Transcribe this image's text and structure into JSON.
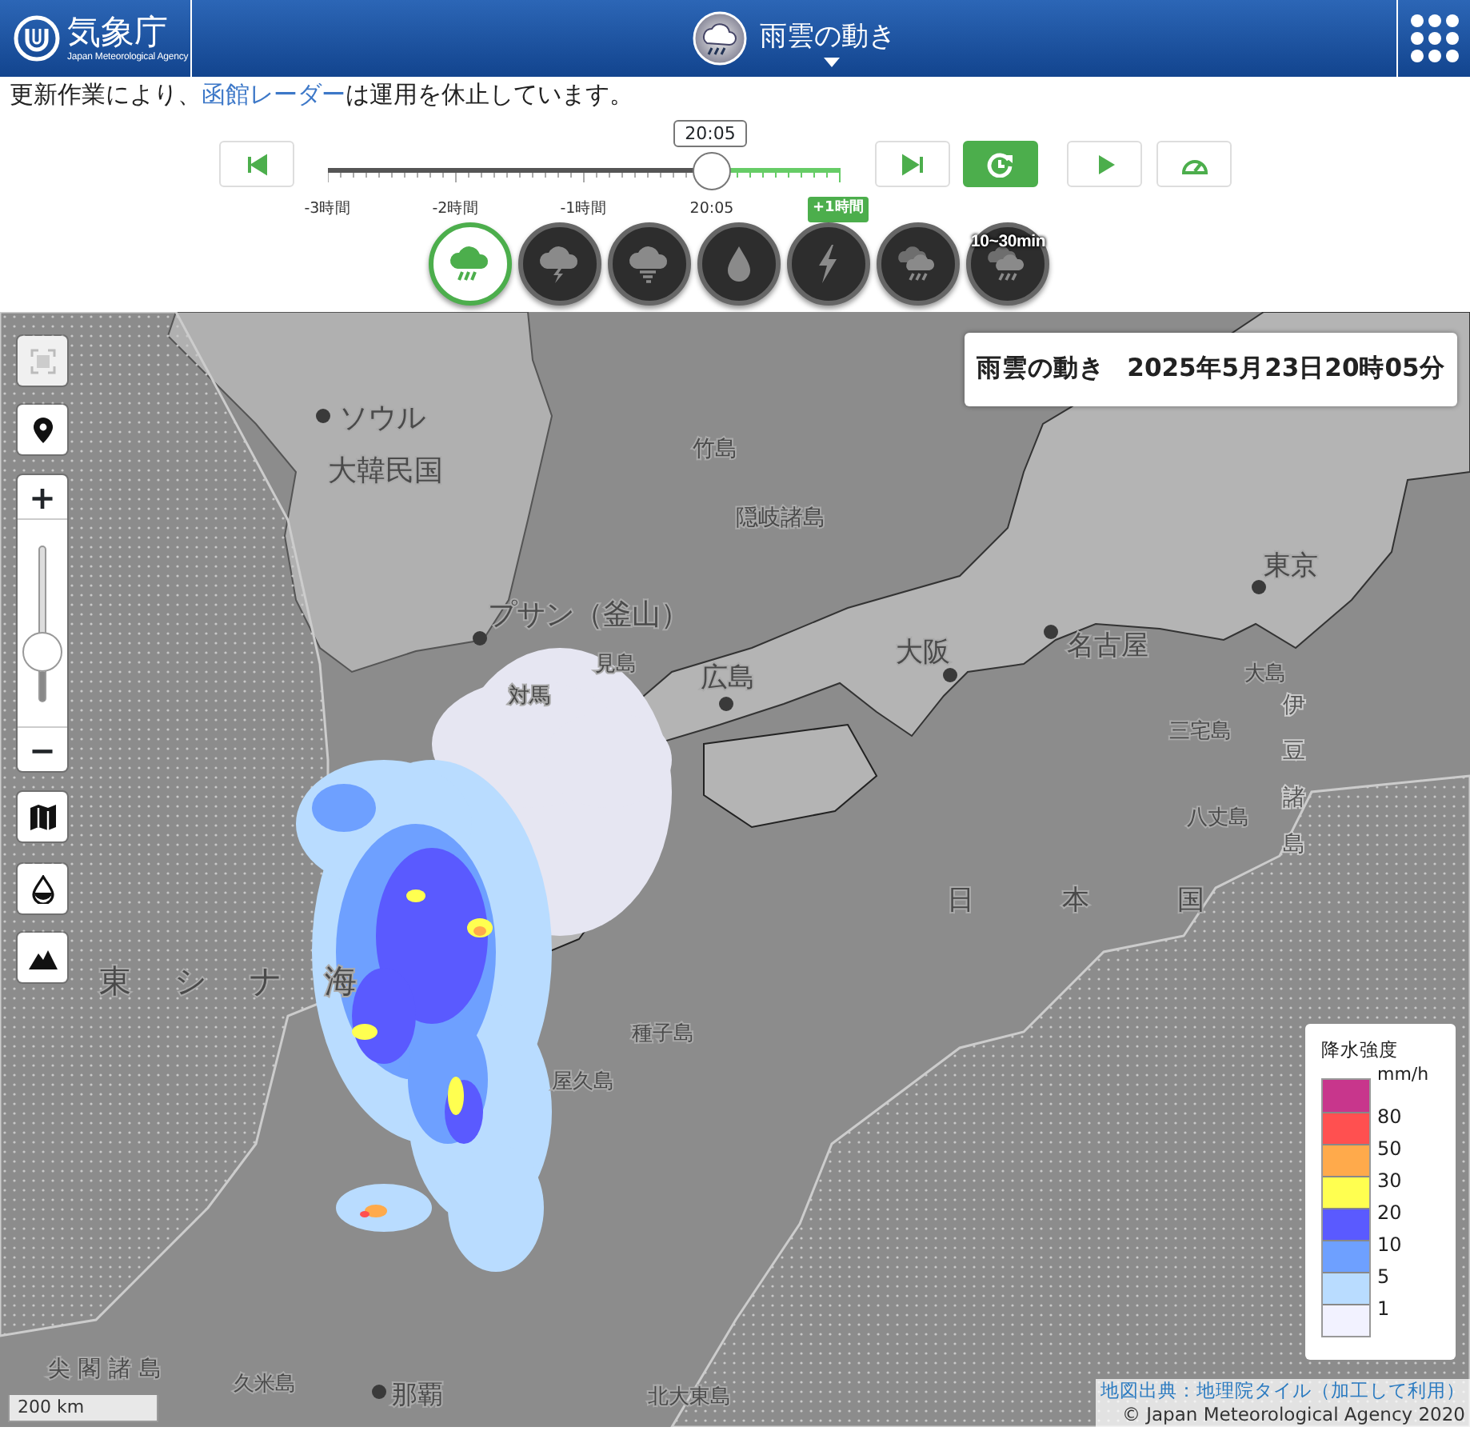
{
  "header": {
    "logo": {
      "name": "気象庁",
      "subtitle": "Japan Meteorological Agency"
    },
    "title": "雨雲の動き"
  },
  "notice": {
    "before": "更新作業により、",
    "link": "函館レーダー",
    "after": "は運用を休止しています。"
  },
  "player": {
    "time": "20:05",
    "level": 0.75,
    "ticks": [
      "-3時間",
      "-2時間",
      "-1時間",
      "20:05"
    ],
    "future_label": "+1時間",
    "buttons": [
      {
        "kind": "first",
        "on": false
      },
      {
        "kind": "last",
        "on": false
      },
      {
        "kind": "refresh",
        "on": true
      },
      {
        "kind": "play",
        "on": false
      },
      {
        "kind": "speed",
        "on": false
      }
    ]
  },
  "modes": [
    {
      "kind": "rain",
      "selected": true
    },
    {
      "kind": "thunder",
      "selected": false
    },
    {
      "kind": "tornado",
      "selected": false
    },
    {
      "kind": "drop",
      "selected": false
    },
    {
      "kind": "lightning",
      "selected": false
    },
    {
      "kind": "nowcast",
      "selected": false
    },
    {
      "kind": "nowcast",
      "label": "10~30min",
      "selected": false
    }
  ],
  "map": {
    "title": "雨雲の動き",
    "datetime": "2025年5月23日20時05分",
    "controls": [
      {
        "kind": "fullscreen",
        "disabled": true
      },
      {
        "kind": "locate",
        "disabled": false
      },
      {
        "kind": "zoom",
        "plus": "+",
        "minus": "−",
        "level": 0.18
      },
      {
        "kind": "basemap",
        "disabled": false
      },
      {
        "kind": "drop",
        "disabled": false
      },
      {
        "kind": "terrain",
        "disabled": false
      }
    ],
    "places": [
      "ソウル",
      "大韓民国",
      "竹島",
      "隠岐諸島",
      "プサン（釜山）",
      "見島",
      "対馬",
      "広島",
      "大阪",
      "名古屋",
      "東京",
      "大島",
      "三宅島",
      "八丈島",
      "伊豆諸島",
      "日本国",
      "東シナ海",
      "種子島",
      "屋久島",
      "尖閣諸島",
      "久米島",
      "那覇",
      "北大東島"
    ],
    "legend": {
      "title": "降水強度",
      "unit": "mm/h",
      "bands": [
        {
          "color": "#c8368c"
        },
        {
          "color": "#ff5050"
        },
        {
          "color": "#ffaa4b"
        },
        {
          "color": "#ffff50"
        },
        {
          "color": "#5a5aff"
        },
        {
          "color": "#6ea0ff"
        },
        {
          "color": "#b9dcff"
        },
        {
          "color": "#f2f2ff"
        }
      ],
      "labels": [
        "80",
        "50",
        "30",
        "20",
        "10",
        "5",
        "1"
      ]
    },
    "scale": "200 km",
    "attribution": {
      "link": "地図出典：地理院タイル（加工して利用）",
      "copyright": "© Japan Meteorological Agency 2020"
    }
  }
}
